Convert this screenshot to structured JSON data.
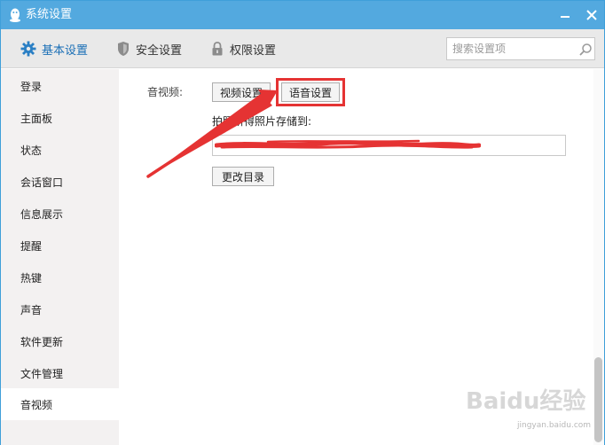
{
  "window": {
    "title": "系统设置"
  },
  "tabs": [
    {
      "label": "基本设置",
      "icon": "gear-icon",
      "active": true
    },
    {
      "label": "安全设置",
      "icon": "shield-icon",
      "active": false
    },
    {
      "label": "权限设置",
      "icon": "lock-icon",
      "active": false
    }
  ],
  "search": {
    "placeholder": "搜索设置项"
  },
  "sidebar": {
    "items": [
      {
        "label": "登录"
      },
      {
        "label": "主面板"
      },
      {
        "label": "状态"
      },
      {
        "label": "会话窗口"
      },
      {
        "label": "信息展示"
      },
      {
        "label": "提醒"
      },
      {
        "label": "热键"
      },
      {
        "label": "声音"
      },
      {
        "label": "软件更新"
      },
      {
        "label": "文件管理"
      },
      {
        "label": "音视频"
      }
    ],
    "active_item": "音视频"
  },
  "content": {
    "section_label": "音视频:",
    "video_settings_button": "视频设置",
    "voice_settings_button": "语音设置",
    "save_label": "拍照所得照片存储到:",
    "path_value": "",
    "change_dir_button": "更改目录"
  },
  "watermark": {
    "text": "Baidu经验",
    "sub": "jingyan.baidu.com"
  },
  "colors": {
    "titlebar": "#53a9df",
    "accent": "#1a6fb6",
    "highlight": "#e53333",
    "sidebar_bg": "#f3f1f1"
  }
}
